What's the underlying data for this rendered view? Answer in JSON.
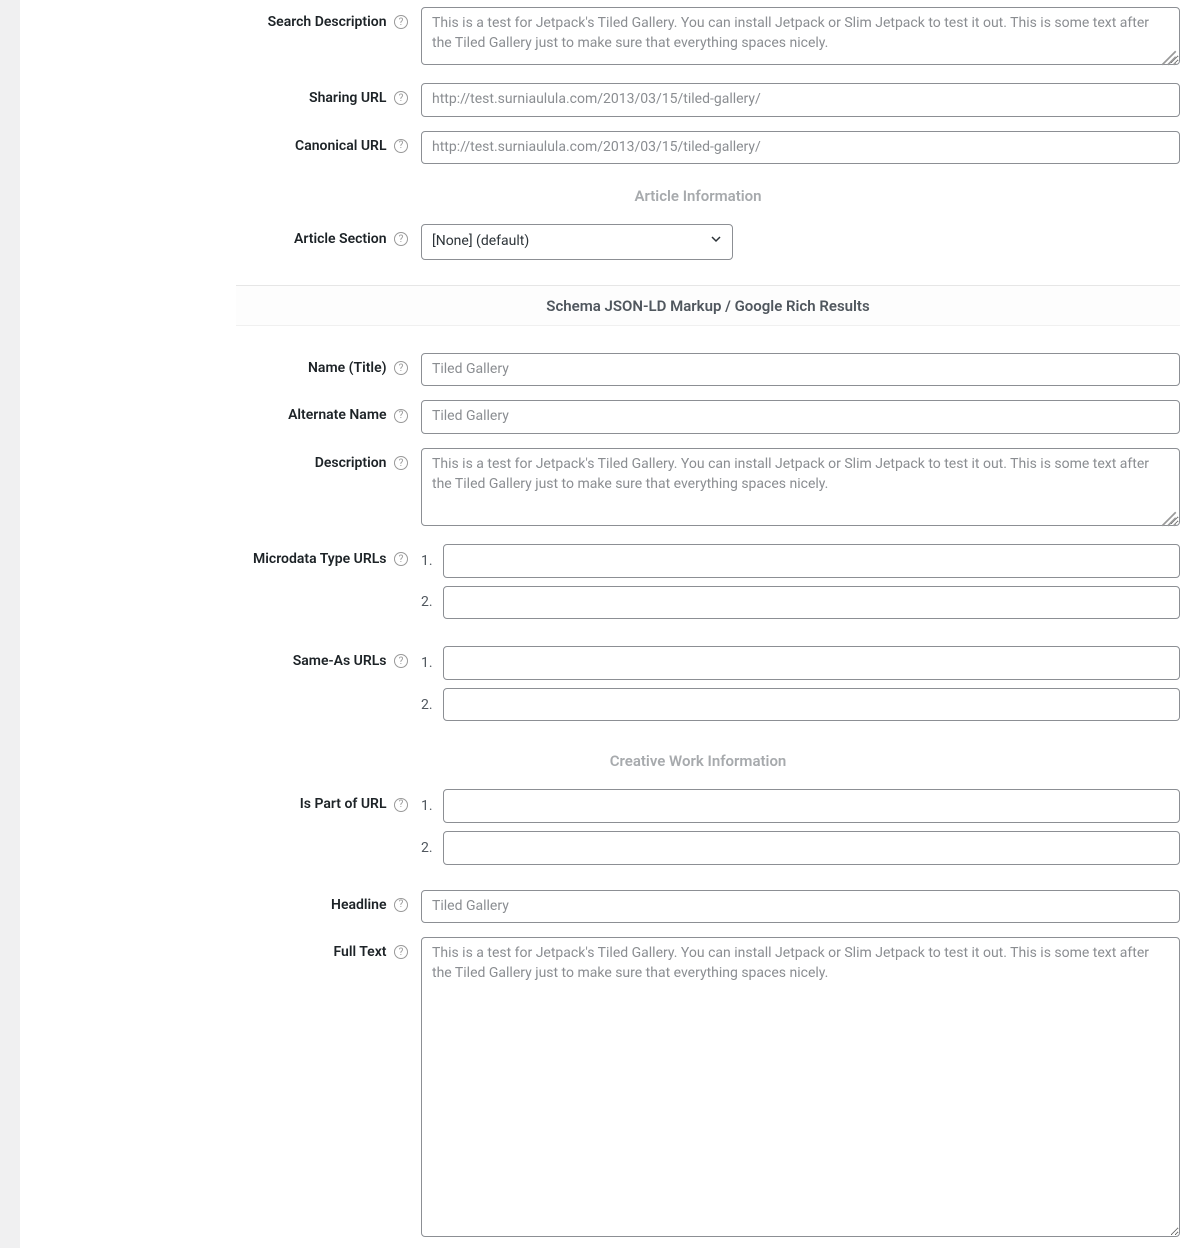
{
  "fields": {
    "search_description": {
      "label": "Search Description",
      "placeholder": "This is a test for Jetpack's Tiled Gallery. You can install Jetpack or Slim Jetpack to test it out. This is some text after the Tiled Gallery just to make sure that everything spaces nicely."
    },
    "sharing_url": {
      "label": "Sharing URL",
      "placeholder": "http://test.surniaulula.com/2013/03/15/tiled-gallery/"
    },
    "canonical_url": {
      "label": "Canonical URL",
      "placeholder": "http://test.surniaulula.com/2013/03/15/tiled-gallery/"
    },
    "article_section": {
      "label": "Article Section",
      "value": "[None] (default)"
    },
    "name_title": {
      "label": "Name (Title)",
      "placeholder": "Tiled Gallery"
    },
    "alternate_name": {
      "label": "Alternate Name",
      "placeholder": "Tiled Gallery"
    },
    "description": {
      "label": "Description",
      "placeholder": "This is a test for Jetpack's Tiled Gallery. You can install Jetpack or Slim Jetpack to test it out. This is some text after the Tiled Gallery just to make sure that everything spaces nicely."
    },
    "microdata_type_urls": {
      "label": "Microdata Type URLs",
      "items": [
        "1.",
        "2."
      ]
    },
    "same_as_urls": {
      "label": "Same-As URLs",
      "items": [
        "1.",
        "2."
      ]
    },
    "is_part_of_url": {
      "label": "Is Part of URL",
      "items": [
        "1.",
        "2."
      ]
    },
    "headline": {
      "label": "Headline",
      "placeholder": "Tiled Gallery"
    },
    "full_text": {
      "label": "Full Text",
      "placeholder": "This is a test for Jetpack's Tiled Gallery. You can install Jetpack or Slim Jetpack to test it out. This is some text after the Tiled Gallery just to make sure that everything spaces nicely."
    }
  },
  "sections": {
    "article_info": "Article Information",
    "schema_header": "Schema JSON-LD Markup / Google Rich Results",
    "creative_work": "Creative Work Information"
  }
}
